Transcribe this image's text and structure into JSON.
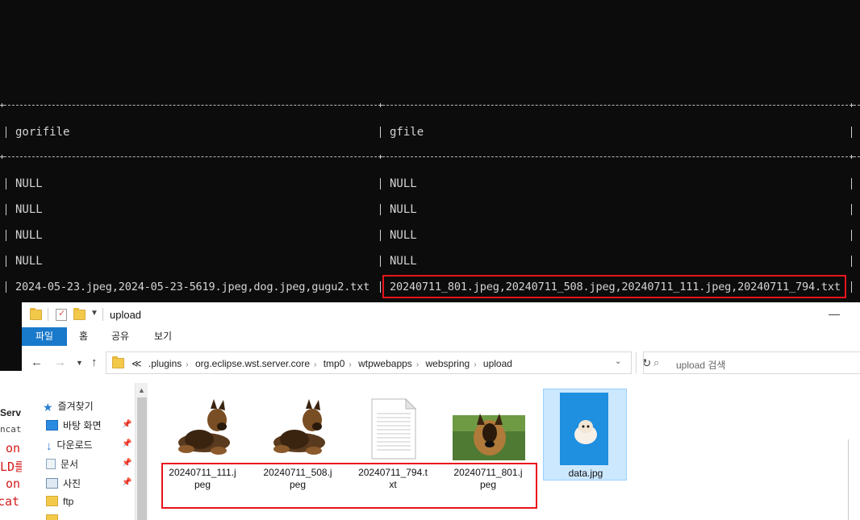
{
  "console": {
    "headers": [
      "gorifile",
      "gfile"
    ],
    "rows": [
      [
        "NULL",
        "NULL"
      ],
      [
        "NULL",
        "NULL"
      ],
      [
        "NULL",
        "NULL"
      ],
      [
        "NULL",
        "NULL"
      ],
      [
        "2024-05-23.jpeg,2024-05-23-5619.jpeg,dog.jpeg,gugu2.txt",
        "20240711_801.jpeg,20240711_508.jpeg,20240711_111.jpeg,20240711_794.txt"
      ]
    ],
    "highlight_color": "#e8141c"
  },
  "background_fragments": [
    "Serv",
    "ncat]",
    "on",
    "LD를",
    "on",
    "cat"
  ],
  "explorer": {
    "title": "upload",
    "ribbon_tabs": [
      "파일",
      "홈",
      "공유",
      "보기"
    ],
    "accent_color": "#1979ca",
    "breadcrumbs": [
      "≪",
      ".plugins",
      "org.eclipse.wst.server.core",
      "tmp0",
      "wtpwebapps",
      "webspring",
      "upload"
    ],
    "search_placeholder": "upload 검색",
    "nav_items": [
      {
        "label": "즐겨찾기",
        "icon": "star-icon"
      },
      {
        "label": "바탕 화면",
        "icon": "desktop-icon"
      },
      {
        "label": "다운로드",
        "icon": "download-icon"
      },
      {
        "label": "문서",
        "icon": "document-icon"
      },
      {
        "label": "사진",
        "icon": "pictures-icon"
      },
      {
        "label": "ftp",
        "icon": "folder-icon"
      }
    ],
    "files": [
      {
        "name_line1": "20240711_111.j",
        "name_line2": "peg",
        "kind": "dog-photo"
      },
      {
        "name_line1": "20240711_508.j",
        "name_line2": "peg",
        "kind": "dog-photo"
      },
      {
        "name_line1": "20240711_794.t",
        "name_line2": "xt",
        "kind": "text-file"
      },
      {
        "name_line1": "20240711_801.j",
        "name_line2": "peg",
        "kind": "shepherd-photo"
      },
      {
        "name_line1": "data.jpg",
        "name_line2": "",
        "kind": "pomeranian-photo"
      }
    ]
  }
}
